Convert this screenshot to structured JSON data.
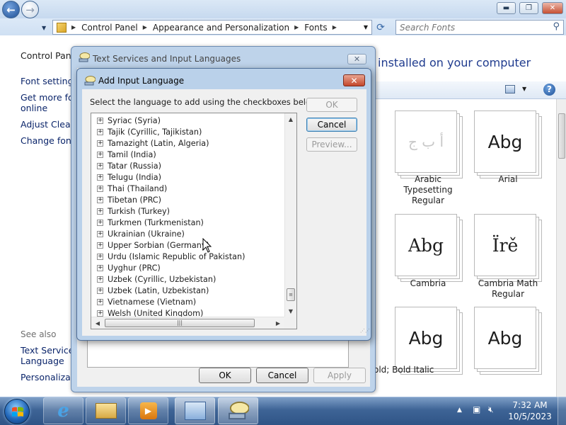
{
  "explorer": {
    "address_crumbs": [
      "Control Panel",
      "Appearance and Personalization",
      "Fonts"
    ],
    "search_placeholder": "Search Fonts",
    "left_pane": {
      "links": [
        "Control Panel",
        "Font settings",
        "Get more font",
        "online",
        "Adjust ClearT",
        "Change font s"
      ],
      "see_also_heading": "See also",
      "see_also_links": [
        "Text Services",
        "Language",
        "Personalizatio"
      ]
    },
    "heading": "installed on your computer",
    "fonts": [
      {
        "preview": "أ ب ج",
        "name_lines": [
          "Arabic",
          "Typesetting",
          "Regular"
        ]
      },
      {
        "preview": "Abg",
        "name_lines": [
          "Arial"
        ]
      },
      {
        "preview": "Abg",
        "name_lines": [
          "Cambria"
        ]
      },
      {
        "preview": "Ïrě",
        "name_lines": [
          "Cambria Math",
          "Regular"
        ]
      },
      {
        "preview": "Abg",
        "name_lines": []
      },
      {
        "preview": "Abg",
        "name_lines": []
      }
    ],
    "style_text": "old; Bold Italic",
    "help_icon": "?"
  },
  "text_services_dialog": {
    "title": "Text Services and Input Languages",
    "close_label": "✕",
    "ok_label": "OK",
    "cancel_label": "Cancel",
    "apply_label": "Apply"
  },
  "add_language_dialog": {
    "title": "Add Input Language",
    "close_label": "✕",
    "instruction": "Select the language to add using the checkboxes below.",
    "ok_label": "OK",
    "cancel_label": "Cancel",
    "preview_label": "Preview...",
    "languages": [
      "Syriac (Syria)",
      "Tajik (Cyrillic, Tajikistan)",
      "Tamazight (Latin, Algeria)",
      "Tamil (India)",
      "Tatar (Russia)",
      "Telugu (India)",
      "Thai (Thailand)",
      "Tibetan (PRC)",
      "Turkish (Turkey)",
      "Turkmen (Turkmenistan)",
      "Ukrainian (Ukraine)",
      "Upper Sorbian (Germany)",
      "Urdu (Islamic Republic of Pakistan)",
      "Uyghur (PRC)",
      "Uzbek (Cyrillic, Uzbekistan)",
      "Uzbek (Latin, Uzbekistan)",
      "Vietnamese (Vietnam)",
      "Welsh (United Kingdom)"
    ]
  },
  "taskbar": {
    "time": "7:32 AM",
    "date": "10/5/2023",
    "apps": [
      "internet-explorer-icon",
      "file-explorer-icon",
      "media-player-icon",
      "control-panel-icon",
      "text-services-icon"
    ]
  },
  "colors": {
    "accent": "#1f3b8e",
    "close_red": "#c4472b",
    "taskbar": "#3e6496"
  }
}
